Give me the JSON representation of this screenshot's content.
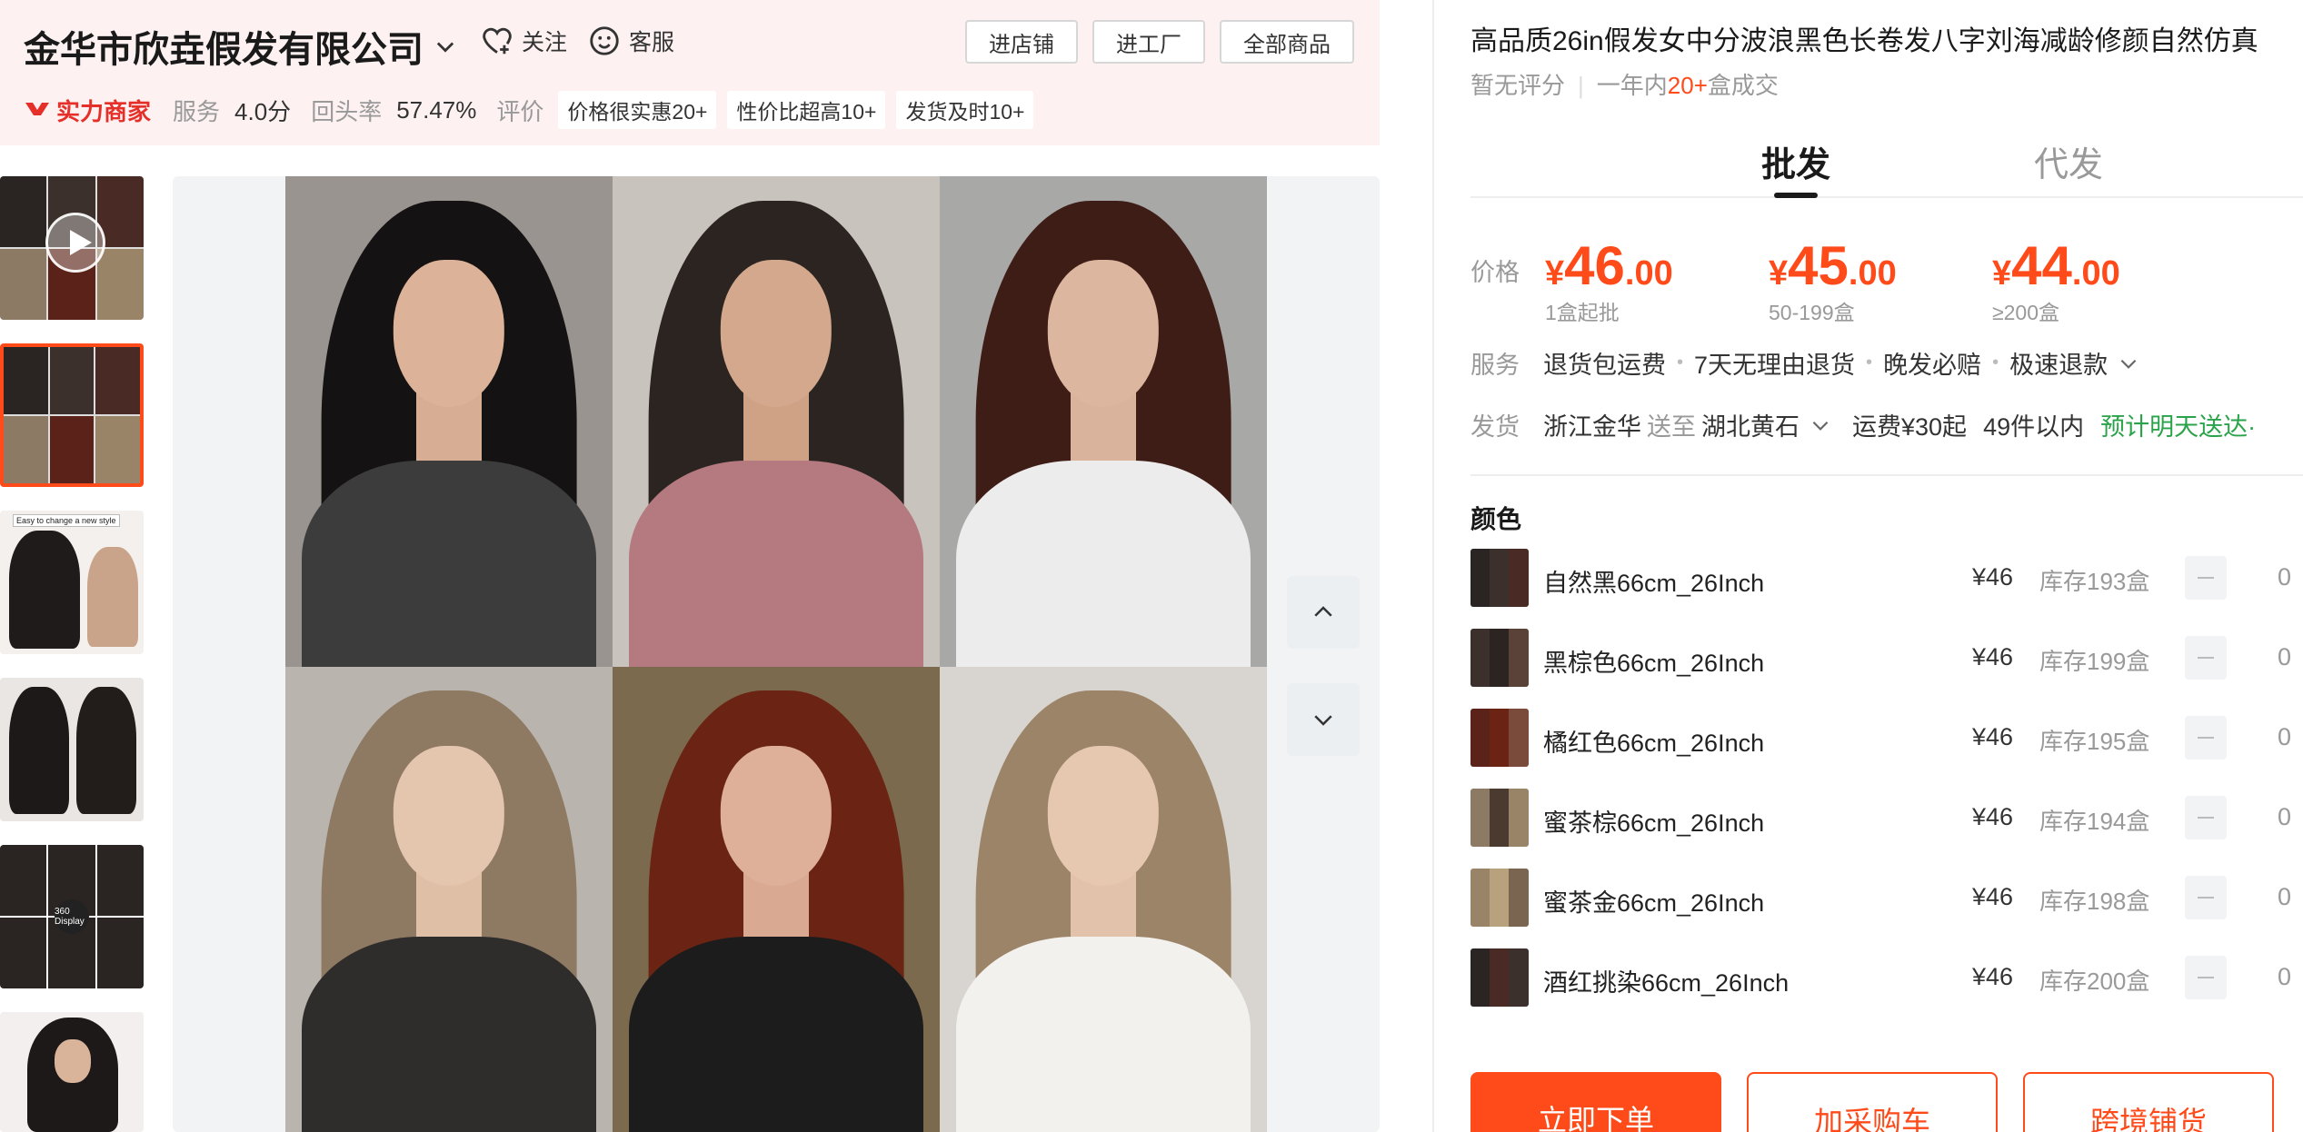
{
  "shop": {
    "name": "金华市欣垚假发有限公司",
    "follow_label": "关注",
    "service_label": "客服",
    "buttons": [
      "进店铺",
      "进工厂",
      "全部商品"
    ],
    "badge": "实力商家",
    "service_score_label": "服务",
    "service_score": "4.0分",
    "repurchase_label": "回头率",
    "repurchase_rate": "57.47%",
    "review_label": "评价",
    "review_tags": [
      "价格很实惠20+",
      "性价比超高10+",
      "发货及时10+"
    ]
  },
  "gallery": {
    "thumb_caption": "Easy to change a new style",
    "badge_360": "360 Display"
  },
  "product": {
    "title": "高品质26in假发女中分波浪黑色长卷发八字刘海减龄修颜自然仿真",
    "rating": "暂无评分",
    "sales_prefix": "一年内",
    "sales_count": "20+",
    "sales_suffix": "盒成交",
    "tabs": [
      {
        "label": "批发",
        "active": true
      },
      {
        "label": "代发",
        "active": false
      }
    ],
    "price_label": "价格",
    "prices": [
      {
        "currency": "¥",
        "int": "46",
        "dec": ".00",
        "tier": "1盒起批"
      },
      {
        "currency": "¥",
        "int": "45",
        "dec": ".00",
        "tier": "50-199盒"
      },
      {
        "currency": "¥",
        "int": "44",
        "dec": ".00",
        "tier": "≥200盒"
      }
    ],
    "service_label": "服务",
    "services": [
      "退货包运费",
      "7天无理由退货",
      "晚发必赔",
      "极速退款"
    ],
    "ship_label": "发货",
    "ship_from": "浙江金华",
    "ship_to_label": "送至",
    "ship_to": "湖北黄石",
    "shipping_fee": "运费¥30起",
    "ship_limit": "49件以内",
    "ship_eta": "预计明天送达·",
    "color_label": "颜色",
    "skus": [
      {
        "name": "自然黑66cm_26Inch",
        "price": "¥46",
        "stock": "库存193盒",
        "qty": "0"
      },
      {
        "name": "黑棕色66cm_26Inch",
        "price": "¥46",
        "stock": "库存199盒",
        "qty": "0"
      },
      {
        "name": "橘红色66cm_26Inch",
        "price": "¥46",
        "stock": "库存195盒",
        "qty": "0"
      },
      {
        "name": "蜜茶棕66cm_26Inch",
        "price": "¥46",
        "stock": "库存194盒",
        "qty": "0"
      },
      {
        "name": "蜜茶金66cm_26Inch",
        "price": "¥46",
        "stock": "库存198盒",
        "qty": "0"
      },
      {
        "name": "酒红挑染66cm_26Inch",
        "price": "¥46",
        "stock": "库存200盒",
        "qty": "0"
      }
    ],
    "actions": [
      "立即下单",
      "加采购车",
      "跨境铺货"
    ]
  },
  "colors": {
    "accent": "#ff4a1a",
    "badge_red": "#e5302a",
    "eta_green": "#2aa34a",
    "header_bg": "#fdf1f1"
  }
}
